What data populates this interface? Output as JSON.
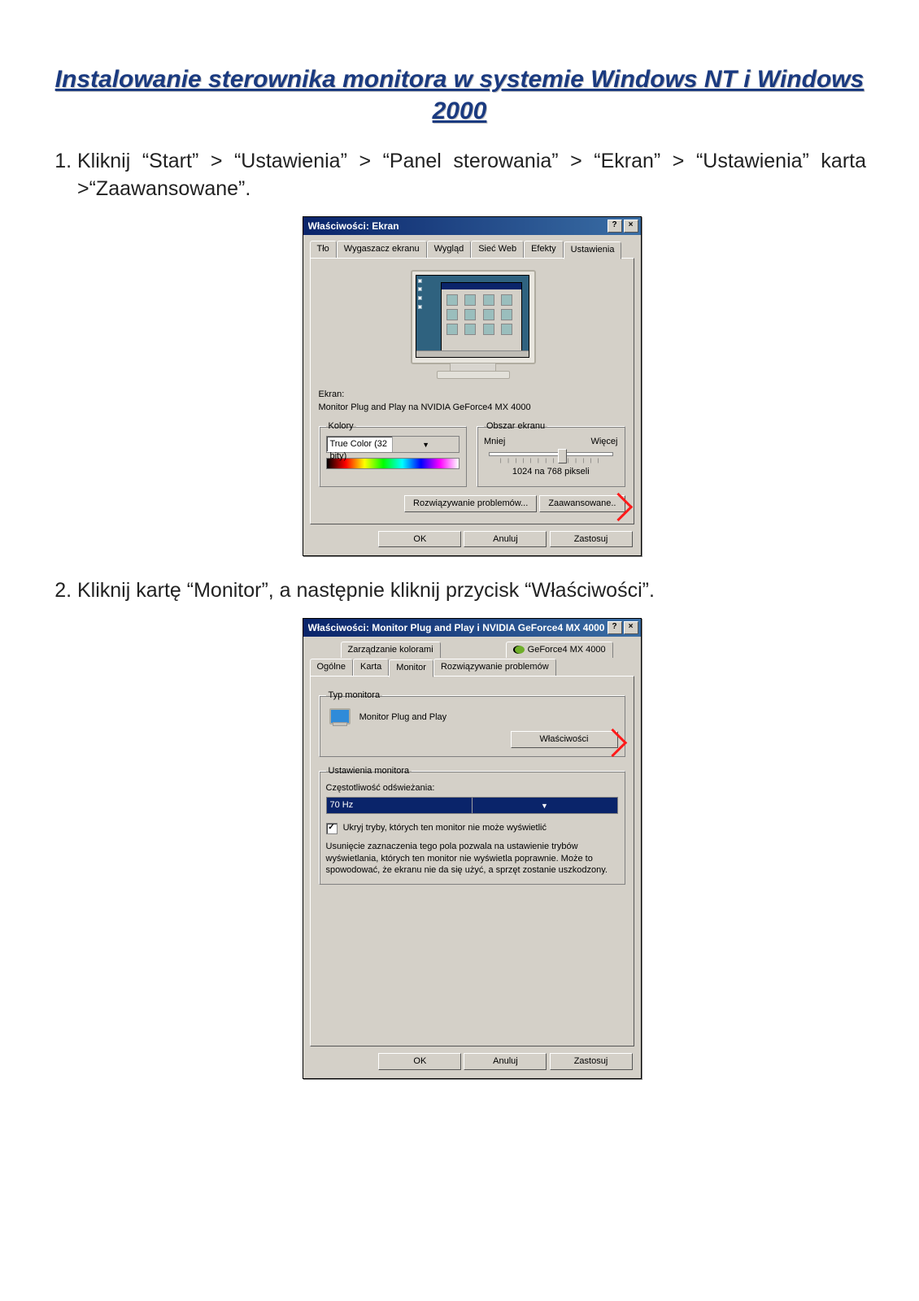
{
  "title": "Instalowanie sterownika monitora w systemie Windows NT i Windows 2000",
  "steps": {
    "s1": "Kliknij “Start” > “Ustawienia” > “Panel sterowania” > “Ekran” > “Ustawienia” karta >“Zaawansowane”.",
    "s2": "Kliknij kartę “Monitor”, a następnie kliknij przycisk “Właściwości”."
  },
  "dialog1": {
    "title": "Właściwości: Ekran",
    "help": "?",
    "close": "×",
    "tabs": {
      "t0": "Tło",
      "t1": "Wygaszacz ekranu",
      "t2": "Wygląd",
      "t3": "Sieć Web",
      "t4": "Efekty",
      "t5": "Ustawienia"
    },
    "ekran_label": "Ekran:",
    "ekran_value": "Monitor Plug and Play na NVIDIA GeForce4 MX 4000",
    "kolory_legend": "Kolory",
    "kolory_value": "True Color (32 bity)",
    "obszar_legend": "Obszar ekranu",
    "mniej": "Mniej",
    "wiecej": "Więcej",
    "res_text": "1024 na 768 pikseli",
    "btn_trouble": "Rozwiązywanie problemów...",
    "btn_adv": "Zaawansowane..",
    "ok": "OK",
    "anuluj": "Anuluj",
    "zastosuj": "Zastosuj"
  },
  "dialog2": {
    "title": "Właściwości: Monitor Plug and Play i NVIDIA GeForce4 MX 4000",
    "help": "?",
    "close": "×",
    "tabs_back": {
      "t0": "Zarządzanie kolorami",
      "t1": "GeForce4 MX 4000"
    },
    "tabs_front": {
      "t0": "Ogólne",
      "t1": "Karta",
      "t2": "Monitor",
      "t3": "Rozwiązywanie problemów"
    },
    "typ_legend": "Typ monitora",
    "monitor_name": "Monitor Plug and Play",
    "btn_props": "Właściwości",
    "ust_legend": "Ustawienia monitora",
    "freq_label": "Częstotliwość odświeżania:",
    "freq_value": "70 Hz",
    "hide_modes": "Ukryj tryby, których ten monitor nie może wyświetlić",
    "help_text": "Usunięcie zaznaczenia tego pola pozwala na ustawienie trybów wyświetlania, których ten monitor nie wyświetla poprawnie. Może to spowodować, że ekranu nie da się użyć, a sprzęt zostanie uszkodzony.",
    "ok": "OK",
    "anuluj": "Anuluj",
    "zastosuj": "Zastosuj"
  }
}
